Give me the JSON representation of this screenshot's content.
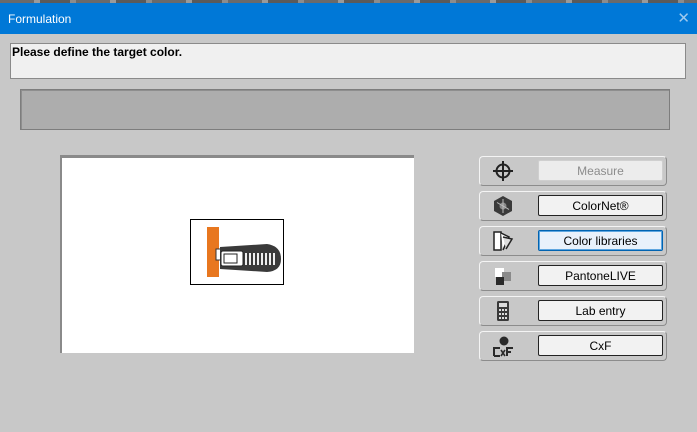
{
  "window": {
    "title": "Formulation",
    "close_glyph": "✕"
  },
  "prompt": {
    "text": "Please define the target color."
  },
  "preview": {
    "image": "measuring-device-icon"
  },
  "options": [
    {
      "icon": "crosshair-icon",
      "label": "Measure",
      "enabled": false,
      "selected": false
    },
    {
      "icon": "colornet-icon",
      "label": "ColorNet®",
      "enabled": true,
      "selected": false
    },
    {
      "icon": "color-swatch-fan-icon",
      "label": "Color libraries",
      "enabled": true,
      "selected": true
    },
    {
      "icon": "pantonelive-icon",
      "label": "PantoneLIVE",
      "enabled": true,
      "selected": false
    },
    {
      "icon": "calculator-icon",
      "label": "Lab entry",
      "enabled": true,
      "selected": false
    },
    {
      "icon": "cxf-icon",
      "label": "CxF",
      "enabled": true,
      "selected": false
    }
  ],
  "colors": {
    "titlebar": "#0078d7",
    "background": "#c8c8c8",
    "device_orange": "#e8771f"
  }
}
